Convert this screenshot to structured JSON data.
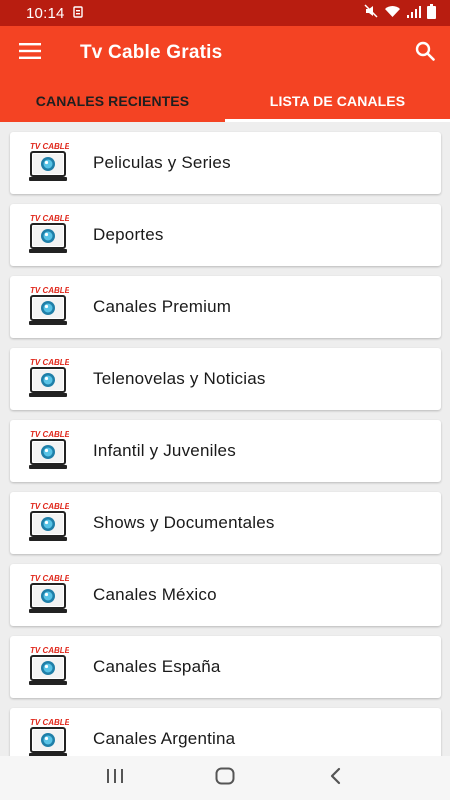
{
  "status_bar": {
    "time": "10:14",
    "icons": [
      "notification-icon",
      "mute-icon",
      "wifi-icon",
      "signal-icon",
      "battery-icon"
    ]
  },
  "app_bar": {
    "title": "Tv Cable Gratis",
    "menu_icon": "hamburger-menu-icon",
    "search_icon": "search-icon",
    "color": "#f44323"
  },
  "tabs": [
    {
      "label": "CANALES RECIENTES",
      "active": false
    },
    {
      "label": "LISTA DE CANALES",
      "active": true
    }
  ],
  "categories": [
    {
      "label": "Peliculas y Series"
    },
    {
      "label": "Deportes"
    },
    {
      "label": "Canales Premium"
    },
    {
      "label": "Telenovelas y Noticias"
    },
    {
      "label": "Infantil y Juveniles"
    },
    {
      "label": "Shows y Documentales"
    },
    {
      "label": "Canales México"
    },
    {
      "label": "Canales España"
    },
    {
      "label": "Canales Argentina"
    }
  ],
  "thumb_logo_text": "TV CABLE",
  "nav_bar": {
    "icons": [
      "recent-apps-icon",
      "home-icon",
      "back-icon"
    ]
  }
}
